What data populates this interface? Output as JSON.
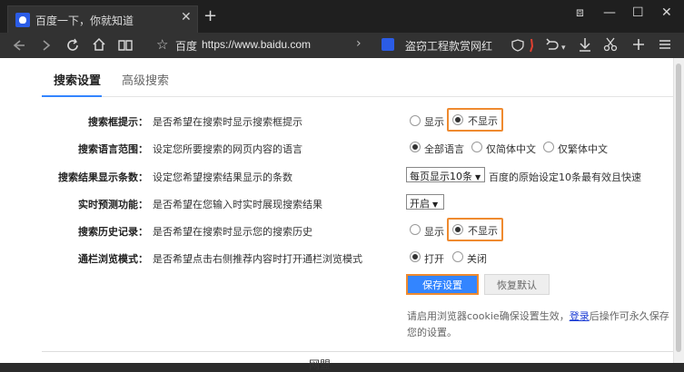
{
  "browser": {
    "tab_title": "百度一下，你就知道",
    "tab_close": "✕",
    "new_tab": "+",
    "window_controls": {
      "restore_down": "⧈",
      "minimize": "—",
      "maximize": "☐",
      "close": "✕"
    },
    "url_site_name": "百度",
    "url": "https://www.baidu.com",
    "news_title": "盗窃工程款赏网红",
    "icons": [
      "back-icon",
      "forward-icon",
      "reload-icon",
      "home-icon",
      "reader-icon",
      "star-icon",
      "shield-icon",
      "undo-icon",
      "download-icon",
      "scissors-icon",
      "add-icon",
      "menu-icon"
    ]
  },
  "settings": {
    "tabs": [
      "搜索设置",
      "高级搜索"
    ],
    "rows": [
      {
        "label": "搜索框提示：",
        "desc": "是否希望在搜索时显示搜索框提示",
        "options": [
          "显示",
          "不显示"
        ]
      },
      {
        "label": "搜索语言范围：",
        "desc": "设定您所要搜索的网页内容的语言",
        "options": [
          "全部语言",
          "仅简体中文",
          "仅繁体中文"
        ]
      },
      {
        "label": "搜索结果显示条数：",
        "desc": "设定您希望搜索结果显示的条数",
        "select": "每页显示10条",
        "extra": "百度的原始设定10条最有效且快速"
      },
      {
        "label": "实时预测功能：",
        "desc": "是否希望在您输入时实时展现搜索结果",
        "select": "开启"
      },
      {
        "label": "搜索历史记录：",
        "desc": "是否希望在搜索时显示您的搜索历史",
        "options": [
          "显示",
          "不显示"
        ]
      },
      {
        "label": "通栏浏览模式：",
        "desc": "是否希望点击右侧推荐内容时打开通栏浏览模式",
        "options": [
          "打开",
          "关闭"
        ]
      }
    ],
    "save_button": "保存设置",
    "reset_button": "恢复默认",
    "note_line1_before": "请启用浏览器cookie确保设置生效，",
    "note_link": "登录",
    "note_line1_after": "后操作可永久保存",
    "note_line2": "您的设置。",
    "footer_partial": "网盟"
  },
  "colors": {
    "accent": "#3385ff",
    "highlight": "#ef8a2f",
    "chrome": "#323232"
  }
}
